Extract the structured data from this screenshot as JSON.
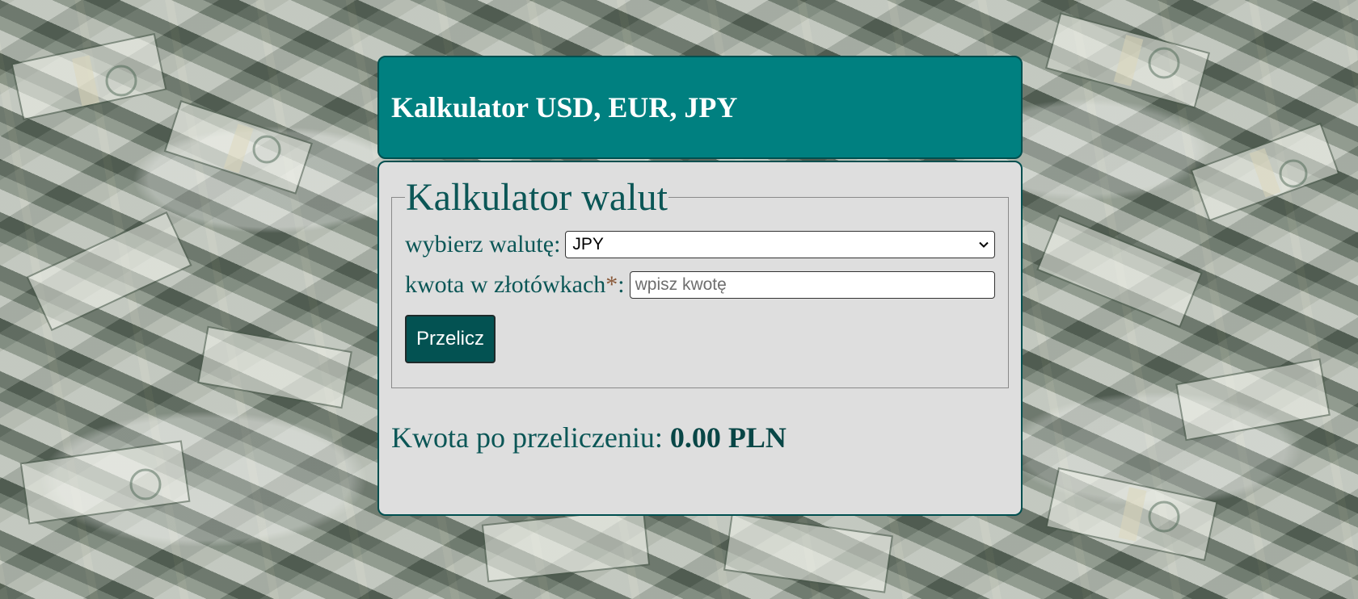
{
  "header": {
    "title": "Kalkulator USD, EUR, JPY"
  },
  "form": {
    "legend": "Kalkulator walut",
    "currency_label": "wybierz walutę:",
    "currency_selected": "JPY",
    "amount_label": "kwota w złotówkach",
    "amount_required_marker": "*",
    "amount_label_suffix": ":",
    "amount_placeholder": "wpisz kwotę",
    "amount_value": "",
    "submit_label": "Przelicz"
  },
  "result": {
    "label": "Kwota po przeliczeniu:",
    "value": "0.00 PLN"
  },
  "theme": {
    "header_bg": "#008080",
    "panel_bg": "#dedede",
    "accent_dark": "#004f4f",
    "button_bg": "#035252",
    "text_color": "#0b5656"
  },
  "icons": {
    "select_arrow": "chevron-down-icon"
  }
}
